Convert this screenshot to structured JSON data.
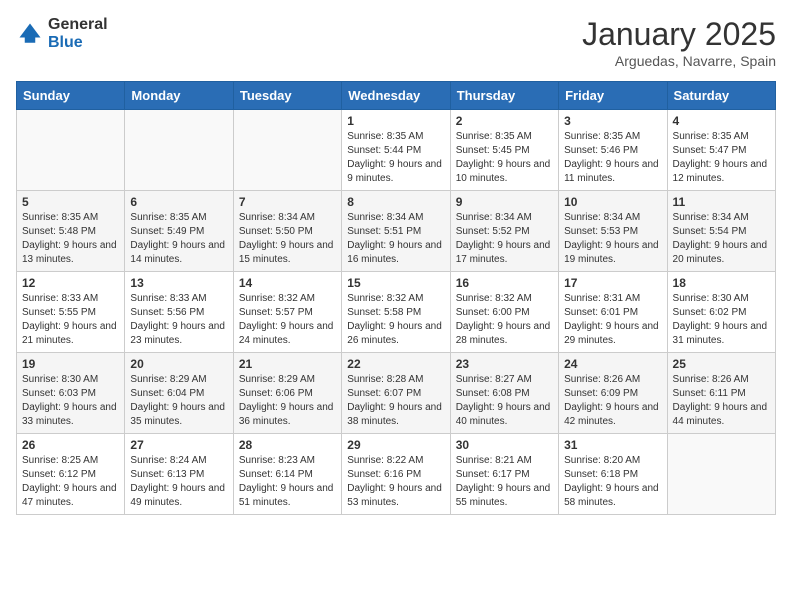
{
  "header": {
    "logo_general": "General",
    "logo_blue": "Blue",
    "month": "January 2025",
    "location": "Arguedas, Navarre, Spain"
  },
  "weekdays": [
    "Sunday",
    "Monday",
    "Tuesday",
    "Wednesday",
    "Thursday",
    "Friday",
    "Saturday"
  ],
  "weeks": [
    [
      {
        "day": "",
        "sunrise": "",
        "sunset": "",
        "daylight": ""
      },
      {
        "day": "",
        "sunrise": "",
        "sunset": "",
        "daylight": ""
      },
      {
        "day": "",
        "sunrise": "",
        "sunset": "",
        "daylight": ""
      },
      {
        "day": "1",
        "sunrise": "Sunrise: 8:35 AM",
        "sunset": "Sunset: 5:44 PM",
        "daylight": "Daylight: 9 hours and 9 minutes."
      },
      {
        "day": "2",
        "sunrise": "Sunrise: 8:35 AM",
        "sunset": "Sunset: 5:45 PM",
        "daylight": "Daylight: 9 hours and 10 minutes."
      },
      {
        "day": "3",
        "sunrise": "Sunrise: 8:35 AM",
        "sunset": "Sunset: 5:46 PM",
        "daylight": "Daylight: 9 hours and 11 minutes."
      },
      {
        "day": "4",
        "sunrise": "Sunrise: 8:35 AM",
        "sunset": "Sunset: 5:47 PM",
        "daylight": "Daylight: 9 hours and 12 minutes."
      }
    ],
    [
      {
        "day": "5",
        "sunrise": "Sunrise: 8:35 AM",
        "sunset": "Sunset: 5:48 PM",
        "daylight": "Daylight: 9 hours and 13 minutes."
      },
      {
        "day": "6",
        "sunrise": "Sunrise: 8:35 AM",
        "sunset": "Sunset: 5:49 PM",
        "daylight": "Daylight: 9 hours and 14 minutes."
      },
      {
        "day": "7",
        "sunrise": "Sunrise: 8:34 AM",
        "sunset": "Sunset: 5:50 PM",
        "daylight": "Daylight: 9 hours and 15 minutes."
      },
      {
        "day": "8",
        "sunrise": "Sunrise: 8:34 AM",
        "sunset": "Sunset: 5:51 PM",
        "daylight": "Daylight: 9 hours and 16 minutes."
      },
      {
        "day": "9",
        "sunrise": "Sunrise: 8:34 AM",
        "sunset": "Sunset: 5:52 PM",
        "daylight": "Daylight: 9 hours and 17 minutes."
      },
      {
        "day": "10",
        "sunrise": "Sunrise: 8:34 AM",
        "sunset": "Sunset: 5:53 PM",
        "daylight": "Daylight: 9 hours and 19 minutes."
      },
      {
        "day": "11",
        "sunrise": "Sunrise: 8:34 AM",
        "sunset": "Sunset: 5:54 PM",
        "daylight": "Daylight: 9 hours and 20 minutes."
      }
    ],
    [
      {
        "day": "12",
        "sunrise": "Sunrise: 8:33 AM",
        "sunset": "Sunset: 5:55 PM",
        "daylight": "Daylight: 9 hours and 21 minutes."
      },
      {
        "day": "13",
        "sunrise": "Sunrise: 8:33 AM",
        "sunset": "Sunset: 5:56 PM",
        "daylight": "Daylight: 9 hours and 23 minutes."
      },
      {
        "day": "14",
        "sunrise": "Sunrise: 8:32 AM",
        "sunset": "Sunset: 5:57 PM",
        "daylight": "Daylight: 9 hours and 24 minutes."
      },
      {
        "day": "15",
        "sunrise": "Sunrise: 8:32 AM",
        "sunset": "Sunset: 5:58 PM",
        "daylight": "Daylight: 9 hours and 26 minutes."
      },
      {
        "day": "16",
        "sunrise": "Sunrise: 8:32 AM",
        "sunset": "Sunset: 6:00 PM",
        "daylight": "Daylight: 9 hours and 28 minutes."
      },
      {
        "day": "17",
        "sunrise": "Sunrise: 8:31 AM",
        "sunset": "Sunset: 6:01 PM",
        "daylight": "Daylight: 9 hours and 29 minutes."
      },
      {
        "day": "18",
        "sunrise": "Sunrise: 8:30 AM",
        "sunset": "Sunset: 6:02 PM",
        "daylight": "Daylight: 9 hours and 31 minutes."
      }
    ],
    [
      {
        "day": "19",
        "sunrise": "Sunrise: 8:30 AM",
        "sunset": "Sunset: 6:03 PM",
        "daylight": "Daylight: 9 hours and 33 minutes."
      },
      {
        "day": "20",
        "sunrise": "Sunrise: 8:29 AM",
        "sunset": "Sunset: 6:04 PM",
        "daylight": "Daylight: 9 hours and 35 minutes."
      },
      {
        "day": "21",
        "sunrise": "Sunrise: 8:29 AM",
        "sunset": "Sunset: 6:06 PM",
        "daylight": "Daylight: 9 hours and 36 minutes."
      },
      {
        "day": "22",
        "sunrise": "Sunrise: 8:28 AM",
        "sunset": "Sunset: 6:07 PM",
        "daylight": "Daylight: 9 hours and 38 minutes."
      },
      {
        "day": "23",
        "sunrise": "Sunrise: 8:27 AM",
        "sunset": "Sunset: 6:08 PM",
        "daylight": "Daylight: 9 hours and 40 minutes."
      },
      {
        "day": "24",
        "sunrise": "Sunrise: 8:26 AM",
        "sunset": "Sunset: 6:09 PM",
        "daylight": "Daylight: 9 hours and 42 minutes."
      },
      {
        "day": "25",
        "sunrise": "Sunrise: 8:26 AM",
        "sunset": "Sunset: 6:11 PM",
        "daylight": "Daylight: 9 hours and 44 minutes."
      }
    ],
    [
      {
        "day": "26",
        "sunrise": "Sunrise: 8:25 AM",
        "sunset": "Sunset: 6:12 PM",
        "daylight": "Daylight: 9 hours and 47 minutes."
      },
      {
        "day": "27",
        "sunrise": "Sunrise: 8:24 AM",
        "sunset": "Sunset: 6:13 PM",
        "daylight": "Daylight: 9 hours and 49 minutes."
      },
      {
        "day": "28",
        "sunrise": "Sunrise: 8:23 AM",
        "sunset": "Sunset: 6:14 PM",
        "daylight": "Daylight: 9 hours and 51 minutes."
      },
      {
        "day": "29",
        "sunrise": "Sunrise: 8:22 AM",
        "sunset": "Sunset: 6:16 PM",
        "daylight": "Daylight: 9 hours and 53 minutes."
      },
      {
        "day": "30",
        "sunrise": "Sunrise: 8:21 AM",
        "sunset": "Sunset: 6:17 PM",
        "daylight": "Daylight: 9 hours and 55 minutes."
      },
      {
        "day": "31",
        "sunrise": "Sunrise: 8:20 AM",
        "sunset": "Sunset: 6:18 PM",
        "daylight": "Daylight: 9 hours and 58 minutes."
      },
      {
        "day": "",
        "sunrise": "",
        "sunset": "",
        "daylight": ""
      }
    ]
  ]
}
